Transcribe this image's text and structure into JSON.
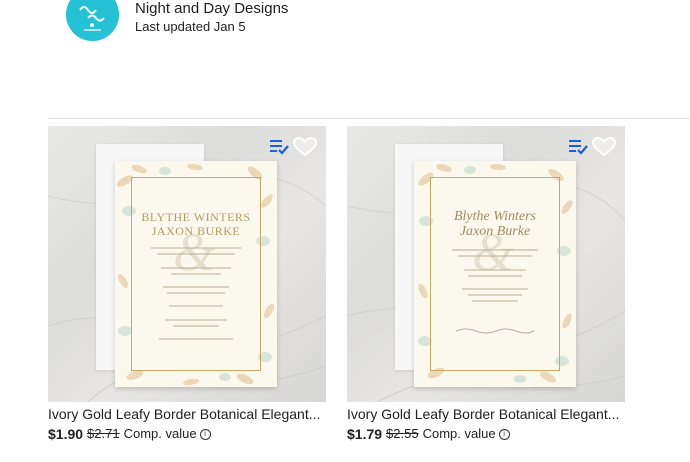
{
  "store": {
    "name": "Night and Day Designs",
    "updated": "Last updated Jan 5",
    "logo_icon": "store-logo-icon",
    "logo_color": "#25c2d6"
  },
  "products": [
    {
      "title": "Ivory Gold Leafy Border Botanical Elegant...",
      "price": "$1.90",
      "compare_price": "$2.71",
      "comp_label": "Comp. value",
      "invitation": {
        "names_line1": "BLYTHE WINTERS",
        "names_line2": "JAXON BURKE"
      }
    },
    {
      "title": "Ivory Gold Leafy Border Botanical Elegant...",
      "price": "$1.79",
      "compare_price": "$2.55",
      "comp_label": "Comp. value",
      "invitation": {
        "names_line1": "Blythe Winters",
        "names_line2": "Jaxon Burke"
      }
    }
  ],
  "icons": {
    "collection": "add-to-collection-icon",
    "favorite": "heart-icon",
    "info": "info-icon",
    "collection_color": "#1f5ce0"
  }
}
